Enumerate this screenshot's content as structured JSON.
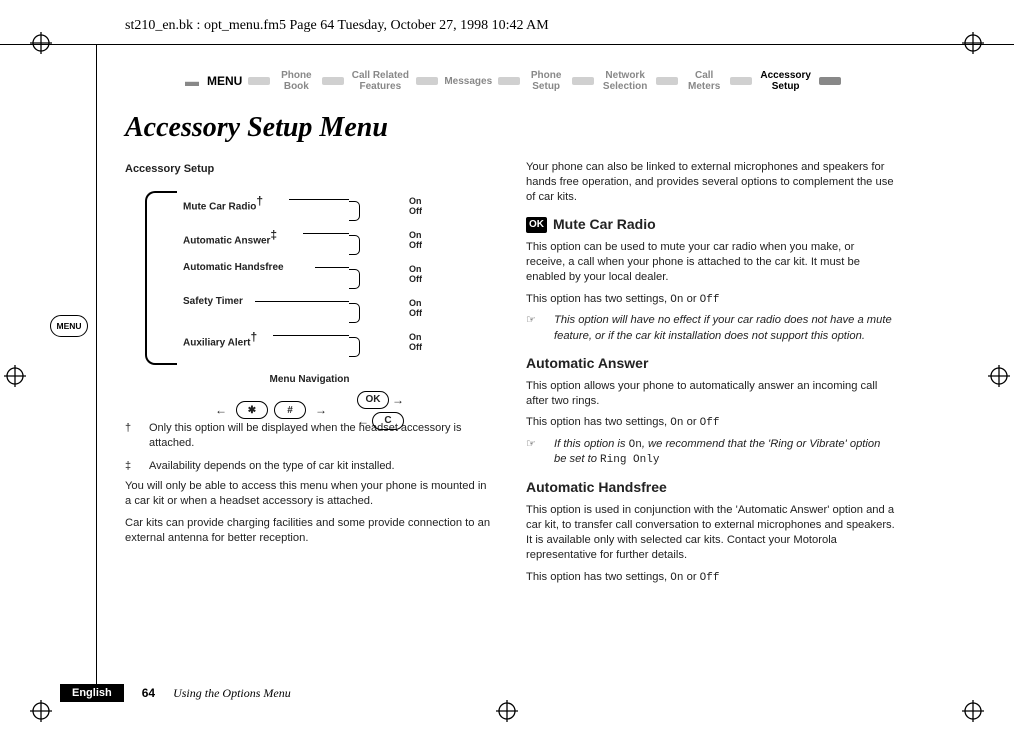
{
  "header": "st210_en.bk : opt_menu.fm5  Page 64  Tuesday, October 27, 1998  10:42 AM",
  "nav": {
    "menu": "MENU",
    "items": [
      "Phone Book",
      "Call Related Features",
      "Messages",
      "Phone Setup",
      "Network Selection",
      "Call Meters",
      "Accessory Setup"
    ]
  },
  "title": "Accessory Setup Menu",
  "diagram": {
    "heading": "Accessory Setup",
    "items": [
      {
        "label": "Mute Car Radio",
        "mark": "†"
      },
      {
        "label": "Automatic Answer",
        "mark": "‡"
      },
      {
        "label": "Automatic Handsfree",
        "mark": ""
      },
      {
        "label": "Safety Timer",
        "mark": ""
      },
      {
        "label": "Auxiliary Alert",
        "mark": "†"
      }
    ],
    "on": "On",
    "off": "Off",
    "nav_label": "Menu Navigation",
    "keys": {
      "star": "✱",
      "hash": "#",
      "ok": "OK",
      "c": "C"
    }
  },
  "footnotes": {
    "dagger": "†",
    "dagger_text": "Only this option will be displayed when the headset accessory is attached.",
    "ddagger": "‡",
    "ddagger_text": "Availability depends on the type of car kit installed."
  },
  "left_paras": {
    "p1": "You will only be able to access this menu when your phone is mounted in a car kit or when a headset accessory is attached.",
    "p2": "Car kits can provide charging facilities and some provide connection to an external antenna for better reception."
  },
  "right": {
    "intro": "Your phone can also be linked to external microphones and speakers for hands free operation, and provides several options to complement the use of car kits.",
    "s1_title": "Mute Car Radio",
    "s1_p1": "This option can be used to mute your car radio when you make, or receive, a call when your phone is attached to the car kit. It must be enabled by your local dealer.",
    "s1_p2_a": "This option has two settings, ",
    "on": "On",
    "or": " or ",
    "off": "Off",
    ".": ".",
    "s1_note": "This option will have no effect if your car radio does not have a mute feature, or if the car kit installation does not support this option.",
    "s2_title": "Automatic Answer",
    "s2_p1": "This option allows your phone to automatically answer an incoming call after two rings.",
    "s2_p2_a": "This option has two settings, ",
    "s2_note_a": "If this option is ",
    "s2_note_b": ", we recommend that the 'Ring or Vibrate' option be set to ",
    "ring_only": "Ring Only",
    "s3_title": "Automatic Handsfree",
    "s3_p1": "This option is used in conjunction with the 'Automatic Answer' option and a car kit, to transfer call conversation to external microphones and speakers. It is available only with selected car kits. Contact your Motorola representative for further details.",
    "s3_p2_a": "This option has two settings, "
  },
  "footer": {
    "lang": "English",
    "page": "64",
    "chapter": "Using the Options Menu"
  },
  "menu_key": "MENU"
}
